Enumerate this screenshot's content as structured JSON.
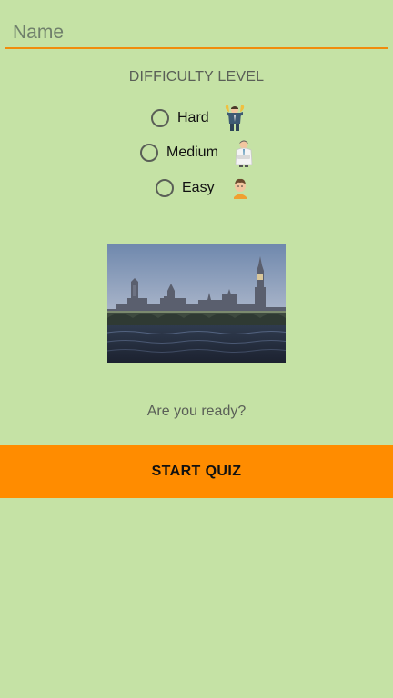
{
  "name_field": {
    "placeholder": "Name",
    "value": ""
  },
  "difficulty": {
    "title": "DIFFICULTY LEVEL",
    "options": [
      {
        "label": "Hard",
        "icon": "strongman-avatar-icon",
        "selected": false
      },
      {
        "label": "Medium",
        "icon": "businessman-avatar-icon",
        "selected": false
      },
      {
        "label": "Easy",
        "icon": "person-avatar-icon",
        "selected": false
      }
    ]
  },
  "image": {
    "subject": "westminster-palace-big-ben-photo"
  },
  "ready_text": "Are you ready?",
  "start_button": {
    "label": "START QUIZ"
  },
  "colors": {
    "background": "#c5e2a5",
    "accent": "#f08c0c",
    "button": "#ff8c00",
    "radio_border": "#5a5f57"
  }
}
